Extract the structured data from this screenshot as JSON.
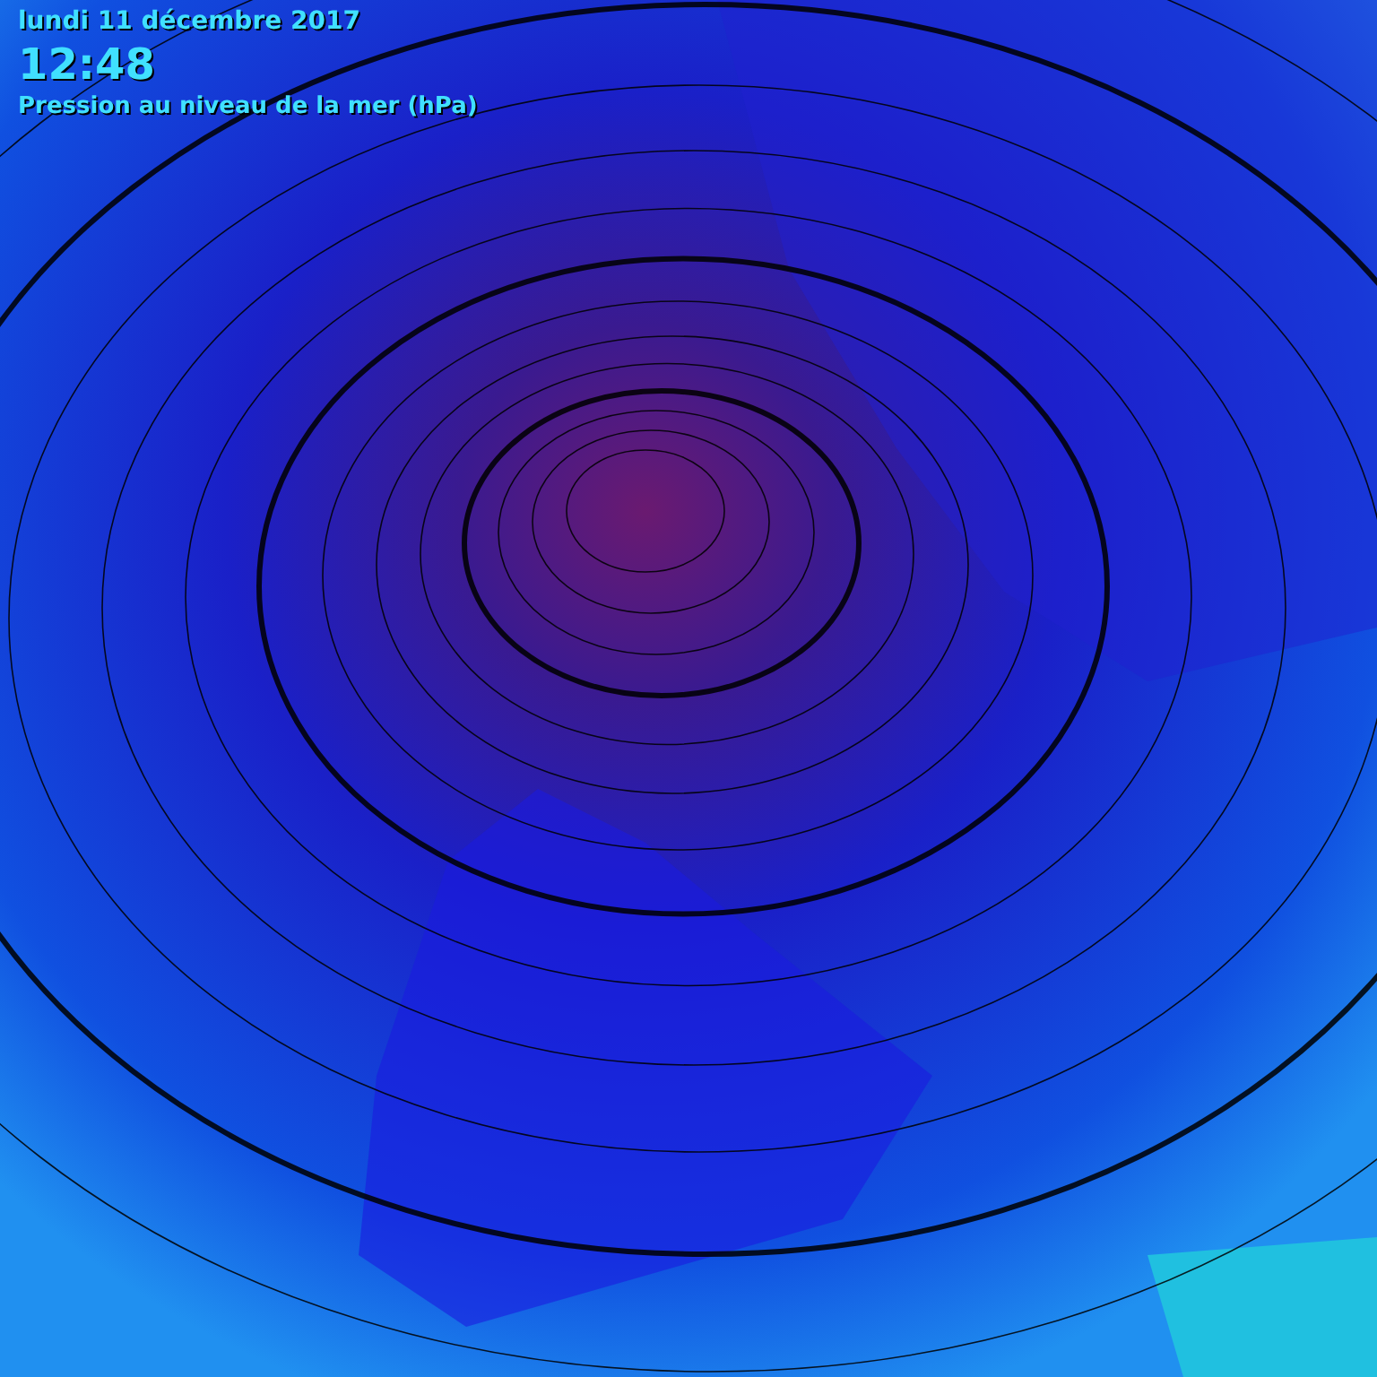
{
  "header": {
    "date": "lundi 11 décembre 2017",
    "time": "12:48",
    "title": "Pression au niveau de la mer (hPa)"
  }
}
